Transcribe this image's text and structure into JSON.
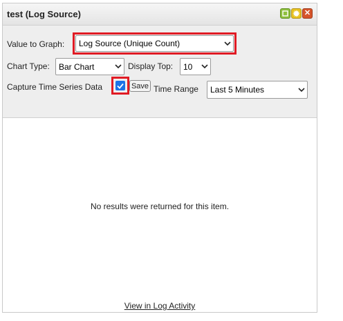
{
  "widget": {
    "title": "test (Log Source)",
    "icons": [
      "restore-icon",
      "settings-gear-icon",
      "close-icon"
    ]
  },
  "config": {
    "value_to_graph_label": "Value to Graph:",
    "value_to_graph_selected": "Log Source (Unique Count)",
    "chart_type_label": "Chart Type:",
    "chart_type_selected": "Bar Chart",
    "display_top_label": "Display Top:",
    "display_top_selected": "10",
    "capture_label": "Capture Time Series Data",
    "capture_checked": true,
    "save_label": "Save",
    "time_range_label": "Time Range",
    "time_range_selected": "Last 5 Minutes"
  },
  "body": {
    "empty_message": "No results were returned for this item.",
    "view_link": "View in Log Activity"
  },
  "colors": {
    "highlight": "#e01b24",
    "checkbox": "#1a73e8"
  }
}
